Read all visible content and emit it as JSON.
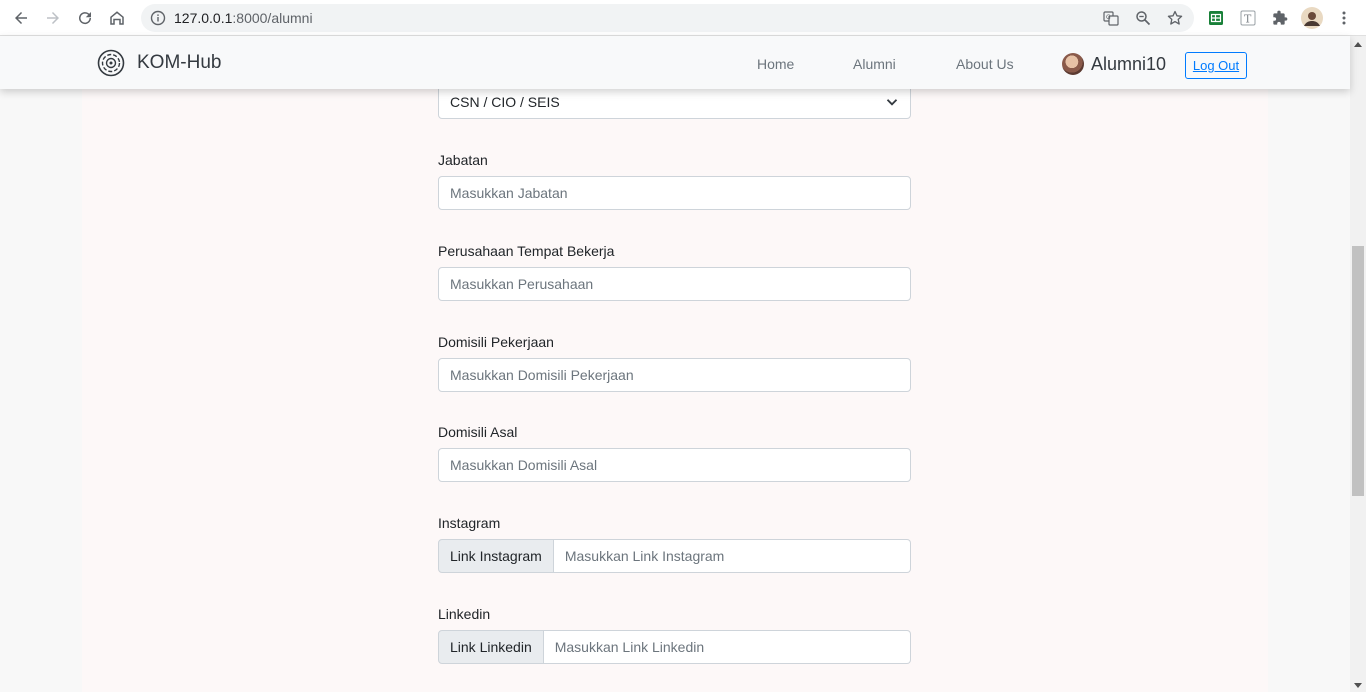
{
  "browser": {
    "url_host": "127.0.0.1",
    "url_path": ":8000/alumni"
  },
  "navbar": {
    "brand": "KOM-Hub",
    "links": [
      "Home",
      "Alumni",
      "About Us"
    ],
    "username": "Alumni10",
    "logout_label": "Log Out"
  },
  "form": {
    "select_value": "CSN / CIO / SEIS",
    "fields": [
      {
        "label": "Jabatan",
        "placeholder": "Masukkan Jabatan"
      },
      {
        "label": "Perusahaan Tempat Bekerja",
        "placeholder": "Masukkan Perusahaan"
      },
      {
        "label": "Domisili Pekerjaan",
        "placeholder": "Masukkan Domisili Pekerjaan"
      },
      {
        "label": "Domisili Asal",
        "placeholder": "Masukkan Domisili Asal"
      }
    ],
    "groups": [
      {
        "label": "Instagram",
        "addon": "Link Instagram",
        "placeholder": "Masukkan Link Instagram"
      },
      {
        "label": "Linkedin",
        "addon": "Link Linkedin",
        "placeholder": "Masukkan Link Linkedin"
      }
    ]
  },
  "icons": [
    "back-icon",
    "forward-icon",
    "reload-icon",
    "home-icon",
    "info-icon",
    "translate-icon",
    "zoom-icon",
    "star-icon",
    "sheets-icon",
    "text-icon",
    "extensions-icon",
    "profile-icon",
    "menu-icon",
    "logo-icon",
    "chevron-down-icon"
  ]
}
